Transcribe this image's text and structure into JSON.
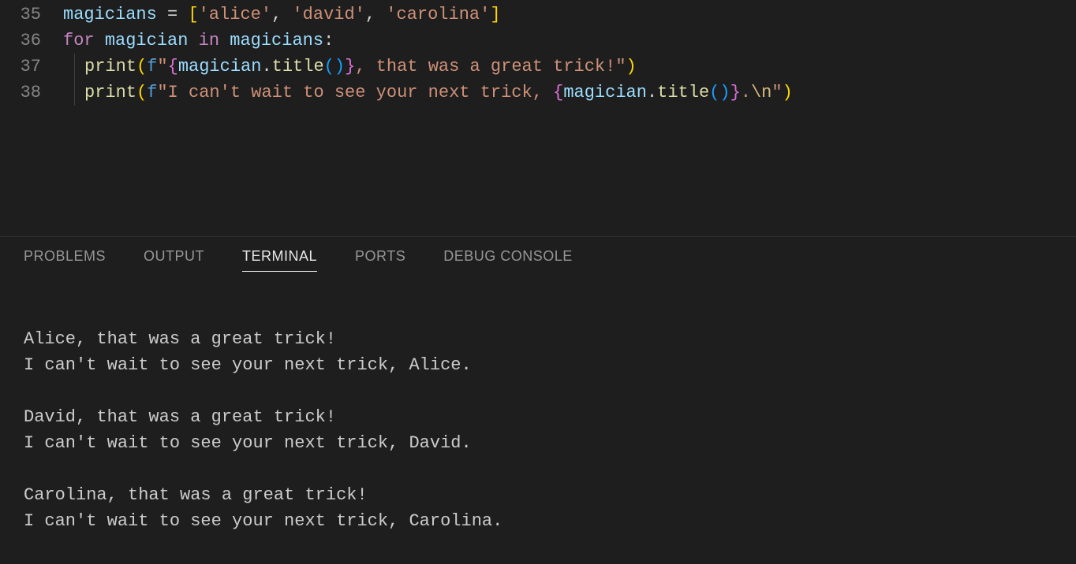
{
  "code": {
    "lines": [
      {
        "num": "35"
      },
      {
        "num": "36"
      },
      {
        "num": "37"
      },
      {
        "num": "38"
      }
    ],
    "tokens": {
      "magicians": "magicians",
      "eq": " = ",
      "lbracket": "[",
      "rbracket": "]",
      "alice": "'alice'",
      "comma_sp": ", ",
      "david": "'david'",
      "carolina": "'carolina'",
      "for": "for",
      "sp": " ",
      "magician": "magician",
      "in": "in",
      "colon": ":",
      "print": "print",
      "lparen": "(",
      "rparen": ")",
      "f": "f",
      "q": "\"",
      "lbrace": "{",
      "rbrace": "}",
      "dot": ".",
      "title": "title",
      "s1a": ", that was a great trick!",
      "s2a": "I can't wait to see your next trick, ",
      "dot2": ".",
      "nl": "\\n"
    }
  },
  "panel": {
    "tabs": {
      "problems": "PROBLEMS",
      "output": "OUTPUT",
      "terminal": "TERMINAL",
      "ports": "PORTS",
      "debug": "DEBUG CONSOLE"
    }
  },
  "terminal": {
    "output": "Alice, that was a great trick!\nI can't wait to see your next trick, Alice.\n\nDavid, that was a great trick!\nI can't wait to see your next trick, David.\n\nCarolina, that was a great trick!\nI can't wait to see your next trick, Carolina."
  }
}
